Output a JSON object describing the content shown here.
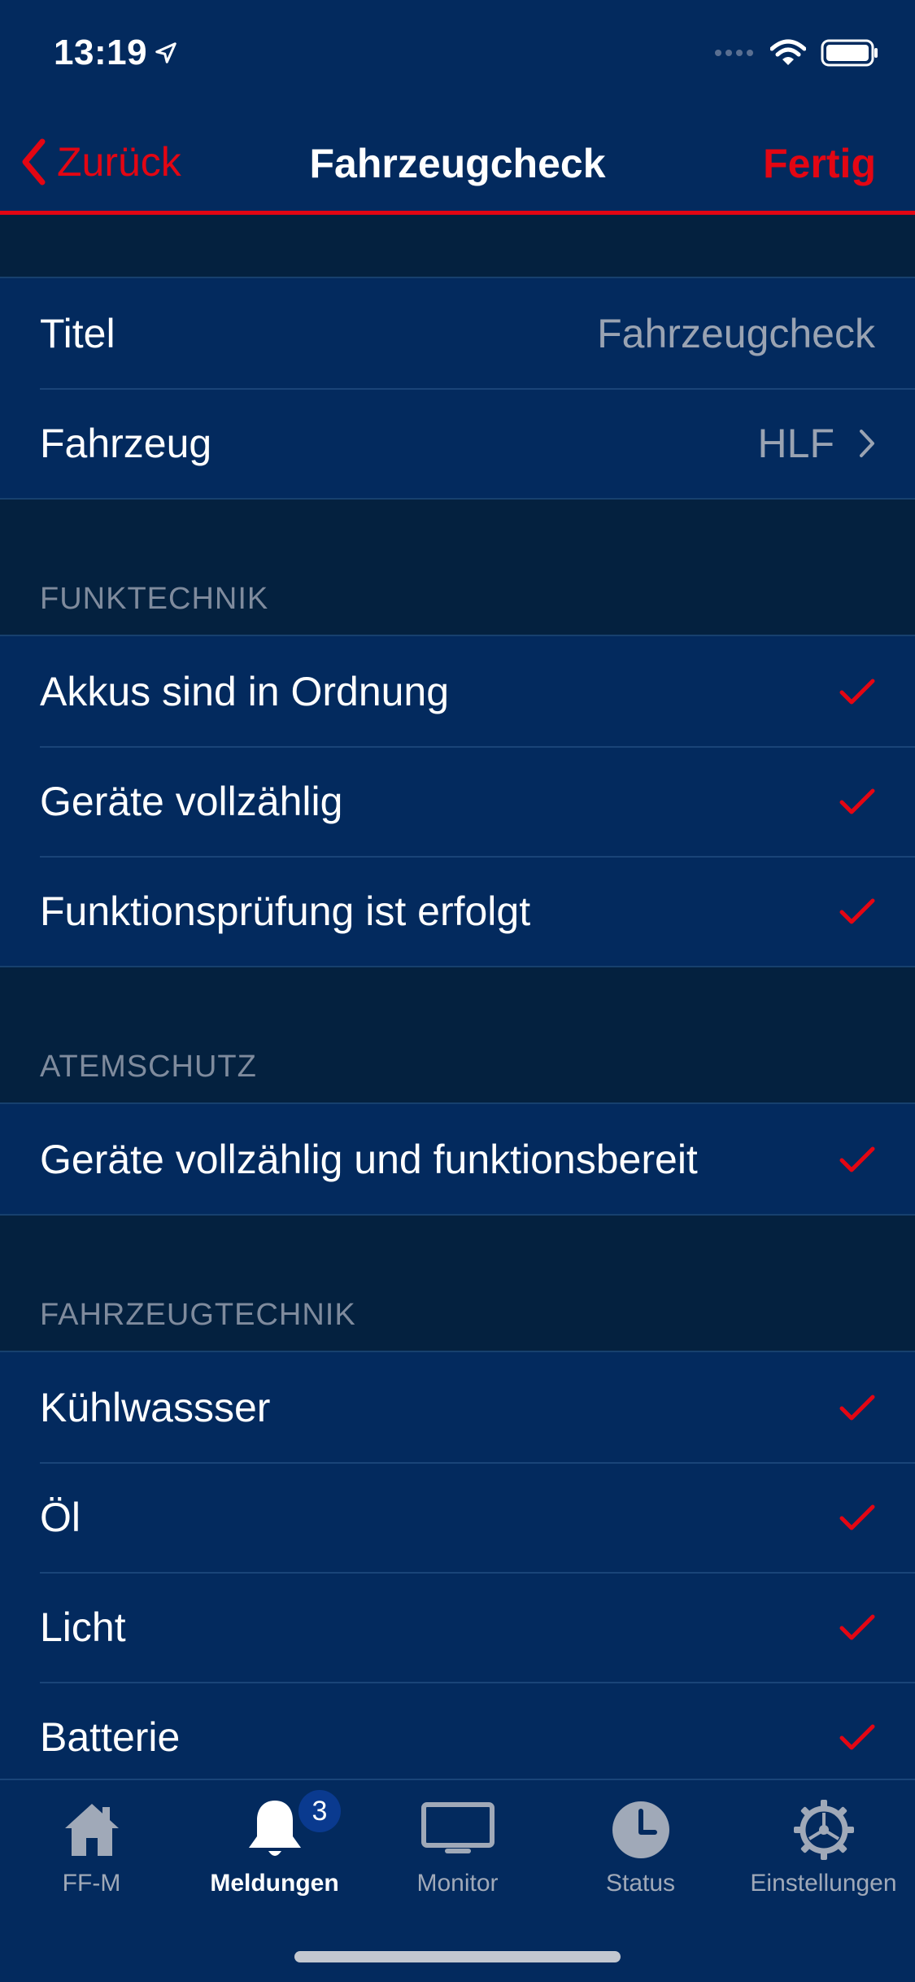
{
  "status_bar": {
    "time": "13:19"
  },
  "nav": {
    "back_label": "Zurück",
    "title": "Fahrzeugcheck",
    "done_label": "Fertig"
  },
  "general": {
    "rows": [
      {
        "label": "Titel",
        "value": "Fahrzeugcheck"
      },
      {
        "label": "Fahrzeug",
        "value": "HLF"
      }
    ]
  },
  "sections": [
    {
      "header": "FUNKTECHNIK",
      "items": [
        {
          "label": "Akkus sind in Ordnung",
          "checked": true
        },
        {
          "label": "Geräte vollzählig",
          "checked": true
        },
        {
          "label": "Funktionsprüfung ist erfolgt",
          "checked": true
        }
      ]
    },
    {
      "header": "ATEMSCHUTZ",
      "items": [
        {
          "label": "Geräte vollzählig und funktionsbereit",
          "checked": true
        }
      ]
    },
    {
      "header": "FAHRZEUGTECHNIK",
      "items": [
        {
          "label": "Kühlwassser",
          "checked": true
        },
        {
          "label": "Öl",
          "checked": true
        },
        {
          "label": "Licht",
          "checked": true
        },
        {
          "label": "Batterie",
          "checked": true
        }
      ]
    }
  ],
  "tabs": [
    {
      "label": "FF-M",
      "icon": "house-icon"
    },
    {
      "label": "Meldungen",
      "icon": "bell-icon",
      "badge": "3",
      "active": true
    },
    {
      "label": "Monitor",
      "icon": "monitor-icon"
    },
    {
      "label": "Status",
      "icon": "clock-icon"
    },
    {
      "label": "Einstellungen",
      "icon": "gear-icon"
    }
  ],
  "colors": {
    "background": "#032a5e",
    "section_background": "#04213f",
    "accent": "#e30613",
    "secondary_text": "#9aa3b2"
  }
}
